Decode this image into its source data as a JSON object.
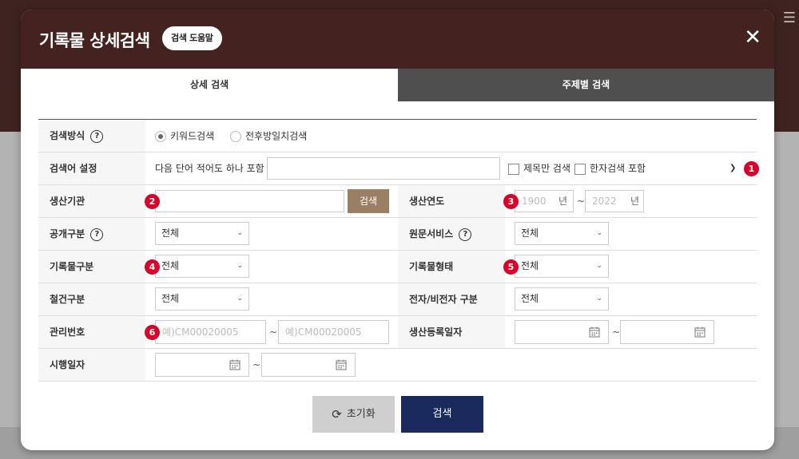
{
  "modal": {
    "title": "기록물 상세검색",
    "help_label": "검색 도움말",
    "close_icon": "close-icon"
  },
  "tabs": [
    {
      "label": "상세 검색",
      "active": true
    },
    {
      "label": "주제별 검색",
      "active": false
    }
  ],
  "form": {
    "search_method": {
      "label": "검색방식",
      "options": [
        {
          "label": "키워드검색",
          "selected": true
        },
        {
          "label": "전후방일치검색",
          "selected": false
        }
      ]
    },
    "term_setting": {
      "label": "검색어 설정",
      "prefix_text": "다음 단어 적어도 하나 포함",
      "value": "",
      "checkbox_title_only": "제목만 검색",
      "checkbox_hanja": "한자검색 포함",
      "badge": "1"
    },
    "producer": {
      "label": "생산기관",
      "value": "",
      "search_button": "검색",
      "badge": "2"
    },
    "production_year": {
      "label": "생산연도",
      "from_placeholder": "1900",
      "to_placeholder": "2022",
      "unit": "년",
      "separator": "~",
      "badge": "3"
    },
    "disclosure": {
      "label": "공개구분",
      "value": "전체"
    },
    "original_service": {
      "label": "원문서비스",
      "value": "전체"
    },
    "record_type": {
      "label": "기록물구분",
      "value": "전체",
      "badge": "4"
    },
    "record_form": {
      "label": "기록물형태",
      "value": "전체",
      "badge": "5"
    },
    "file_type": {
      "label": "철건구분",
      "value": "전체"
    },
    "electronic": {
      "label": "전자/비전자 구분",
      "value": "전체"
    },
    "mgmt_number": {
      "label": "관리번호",
      "from_placeholder": "예)CM00020005",
      "to_placeholder": "예)CM00020005",
      "separator": "~",
      "badge": "6"
    },
    "reg_date": {
      "label": "생산등록일자",
      "separator": "~"
    },
    "exec_date": {
      "label": "시행일자",
      "separator": "~"
    }
  },
  "buttons": {
    "reset": "초기화",
    "search": "검색"
  },
  "colors": {
    "header_bg": "#432220",
    "badge": "#d6002a",
    "search_button": "#1a2a5c",
    "small_search_button": "#9b7f65"
  }
}
